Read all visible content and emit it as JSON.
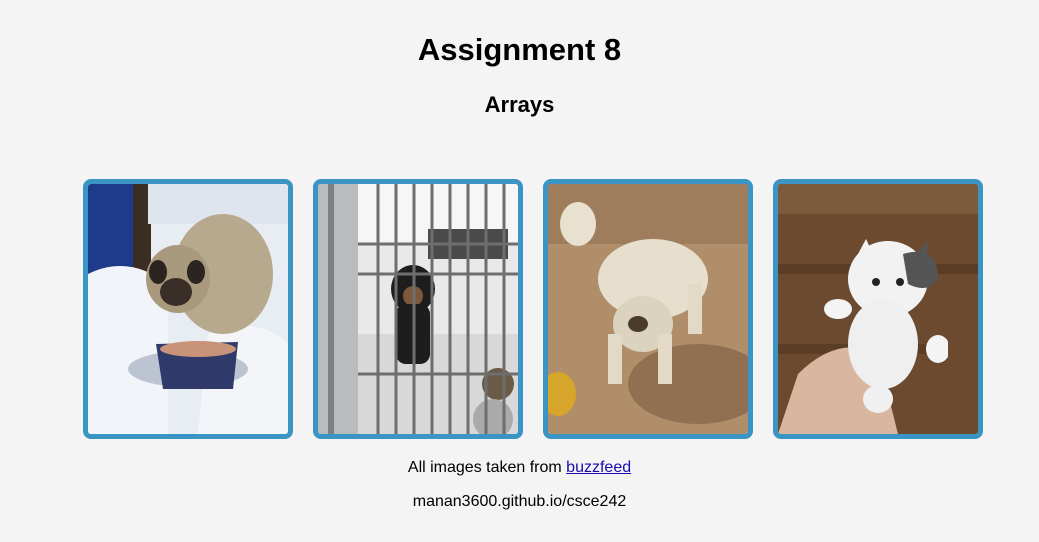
{
  "header": {
    "title": "Assignment 8",
    "subtitle": "Arrays"
  },
  "gallery": {
    "images": [
      {
        "icon": "dog-in-snow-photo"
      },
      {
        "icon": "dog-in-kennel-photo"
      },
      {
        "icon": "white-dog-on-dirt-photo"
      },
      {
        "icon": "white-kitten-held-photo"
      }
    ],
    "border_color": "#3a94c4"
  },
  "credit": {
    "prefix": "All images taken from ",
    "link_text": "buzzfeed"
  },
  "footer": {
    "url_text": "manan3600.github.io/csce242"
  }
}
